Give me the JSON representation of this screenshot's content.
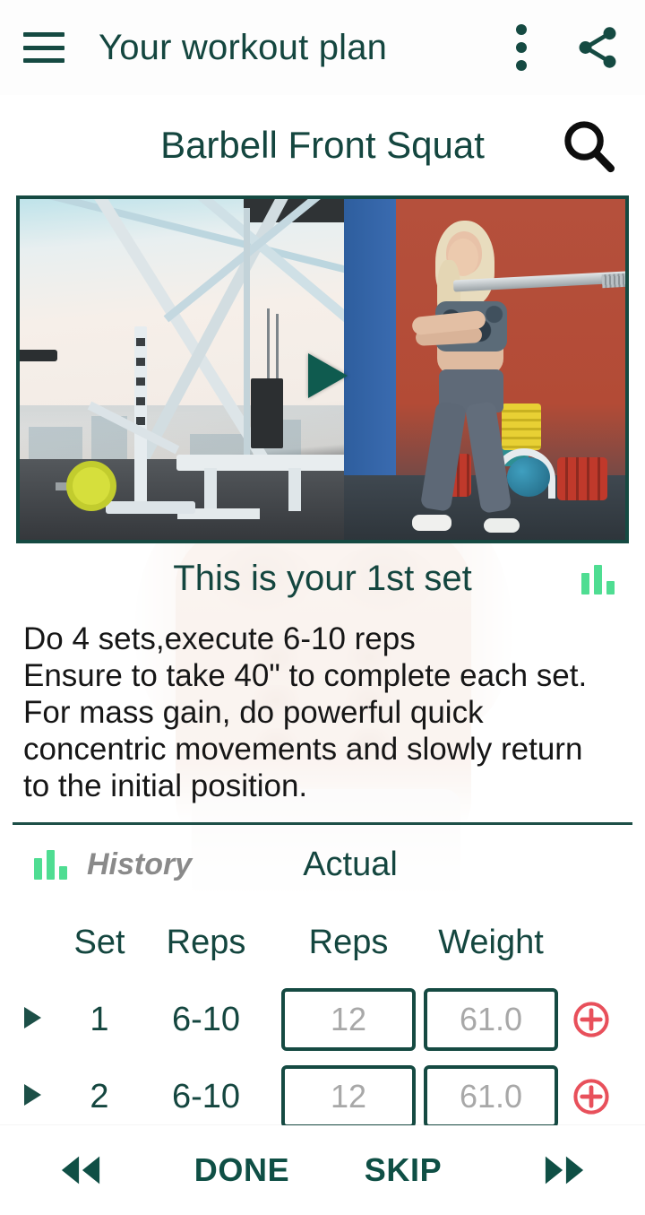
{
  "appbar": {
    "menu_icon": "hamburger-menu-icon",
    "title": "Your workout plan",
    "overflow_icon": "kebab-menu-icon",
    "share_icon": "share-icon"
  },
  "exercise": {
    "name": "Barbell Front Squat",
    "search_icon": "search-icon"
  },
  "video": {
    "play_icon": "play-triangle-icon",
    "alt": "Woman performing barbell front squat in gym"
  },
  "set_section": {
    "heading": "This is your 1st set",
    "chart_icon": "bar-chart-icon"
  },
  "instructions": {
    "text": "Do 4 sets,execute 6-10 reps\nEnsure to take 40\" to complete each set.\nFor mass gain, do powerful quick\nconcentric movements and slowly return\nto the initial position."
  },
  "columns_group": {
    "history_label": "History",
    "history_icon": "bar-chart-icon",
    "actual_label": "Actual"
  },
  "table": {
    "headers": {
      "set": "Set",
      "history_reps": "Reps",
      "actual_reps": "Reps",
      "weight": "Weight"
    },
    "rows": [
      {
        "caret": "expand-caret-icon",
        "set": "1",
        "history_reps": "6-10",
        "actual_reps_placeholder": "12",
        "weight_placeholder": "61.0",
        "add_icon": "add-circle-icon"
      },
      {
        "caret": "expand-caret-icon",
        "set": "2",
        "history_reps": "6-10",
        "actual_reps_placeholder": "12",
        "weight_placeholder": "61.0",
        "add_icon": "add-circle-icon"
      }
    ]
  },
  "bottombar": {
    "prev_icon": "rewind-double-arrow-icon",
    "done_label": "DONE",
    "skip_label": "SKIP",
    "next_icon": "forward-double-arrow-icon"
  },
  "colors": {
    "primary_teal": "#14463f",
    "accent_green": "#4fdd92",
    "add_red": "#e8505b",
    "placeholder_gray": "#a8a8a8",
    "history_gray": "#8a8a8a"
  }
}
